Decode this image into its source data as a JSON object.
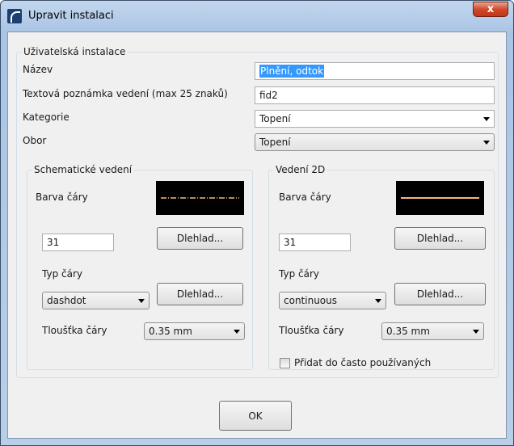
{
  "window": {
    "title": "Upravit instalaci",
    "close_symbol": "x"
  },
  "user_install": {
    "legend": "Uživatelská instalace",
    "name_label": "Název",
    "name_value": "Plnění, odtok",
    "note_label": "Textová poznámka vedení (max 25 znaků)",
    "note_value": "fid2",
    "category_label": "Kategorie",
    "category_value": "Topení",
    "field_label": "Obor",
    "field_value": "Topení"
  },
  "schematic": {
    "legend": "Schematické vedení",
    "color_label": "Barva čáry",
    "color_value": "31",
    "preview_button": "Dlehlad...",
    "linetype_label": "Typ čáry",
    "linetype_value": "dashdot",
    "linetype_preview_button": "Dlehlad...",
    "thickness_label": "Tloušťka čáry",
    "thickness_value": "0.35 mm",
    "line_color": "#f5b87a",
    "line_style": "dashdot"
  },
  "view2d": {
    "legend": "Vedení 2D",
    "color_label": "Barva čáry",
    "color_value": "31",
    "preview_button": "Dlehlad...",
    "linetype_label": "Typ čáry",
    "linetype_value": "continuous",
    "linetype_preview_button": "Dlehlad...",
    "thickness_label": "Tloušťka čáry",
    "thickness_value": "0.35 mm",
    "favorites_label": "Přidat do často používaných",
    "favorites_checked": false,
    "line_color": "#f5b87a",
    "line_style": "continuous"
  },
  "ok_label": "OK"
}
